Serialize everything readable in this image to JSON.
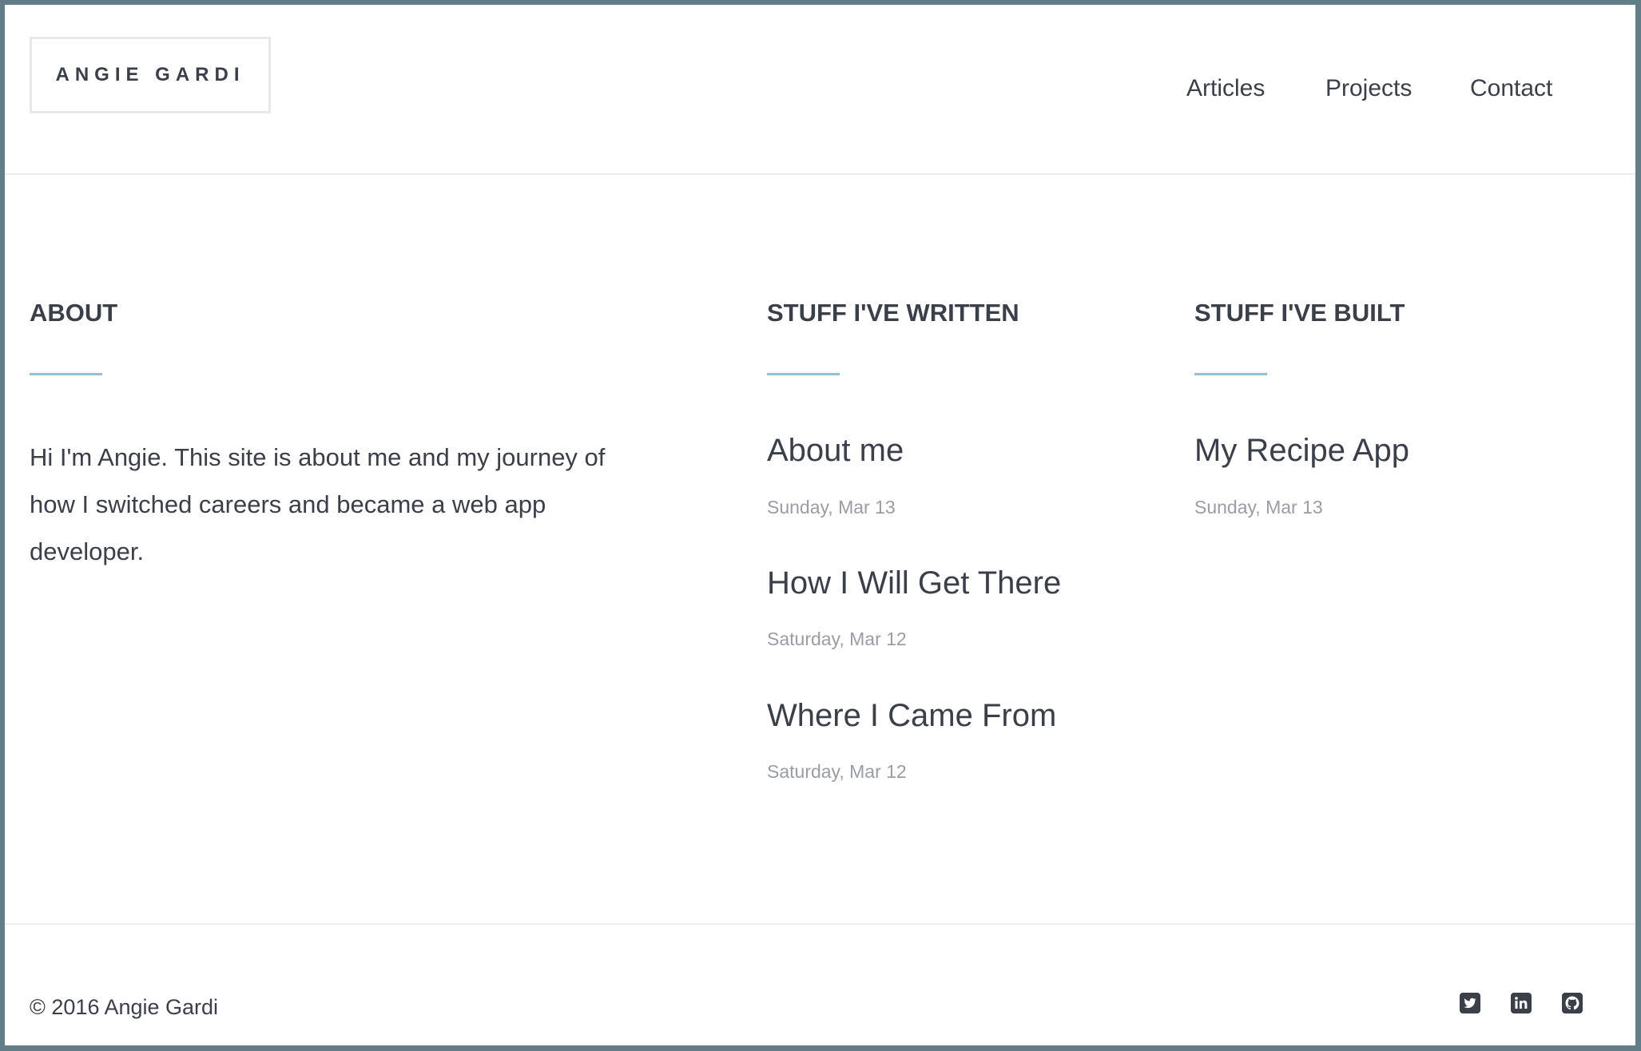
{
  "header": {
    "logo": "ANGIE GARDI",
    "nav": [
      "Articles",
      "Projects",
      "Contact"
    ]
  },
  "about": {
    "heading": "ABOUT",
    "text": "Hi I'm Angie. This site is about me and my journey of how I switched careers and became a web app developer."
  },
  "written": {
    "heading": "STUFF I'VE WRITTEN",
    "items": [
      {
        "title": "About me",
        "date": "Sunday, Mar 13"
      },
      {
        "title": "How I Will Get There",
        "date": "Saturday, Mar 12"
      },
      {
        "title": "Where I Came From",
        "date": "Saturday, Mar 12"
      }
    ]
  },
  "built": {
    "heading": "STUFF I'VE BUILT",
    "items": [
      {
        "title": "My Recipe App",
        "date": "Sunday, Mar 13"
      }
    ]
  },
  "footer": {
    "copyright": "© 2016 Angie Gardi",
    "social_icons": [
      "twitter-icon",
      "linkedin-icon",
      "github-icon"
    ]
  },
  "colors": {
    "border": "#607d88",
    "accent": "#8ec4d4",
    "text": "#3b3f48",
    "muted": "#9a9da3"
  }
}
